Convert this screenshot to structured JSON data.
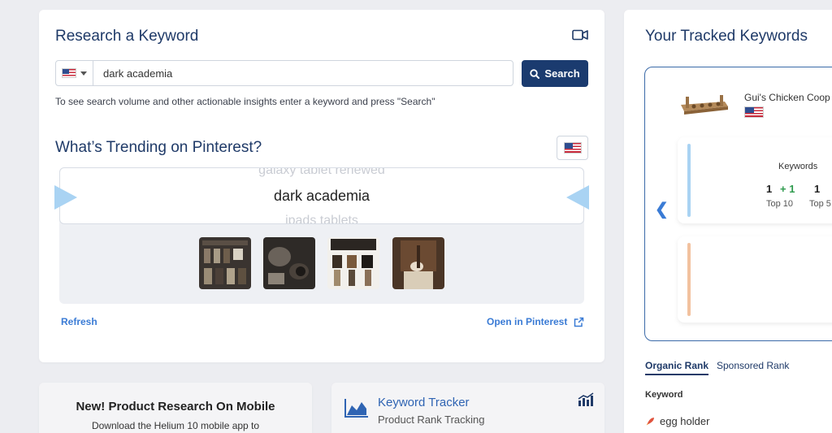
{
  "research": {
    "title": "Research a Keyword",
    "country": "US",
    "keyword_value": "dark academia",
    "search_label": "Search",
    "helper_text": "To see search volume and other actionable insights enter a keyword and press \"Search\""
  },
  "trending": {
    "title": "What’s Trending on Pinterest?",
    "prev_item": "galaxy tablet renewed",
    "current_item": "dark academia",
    "next_item": "ipads tablets",
    "refresh_label": "Refresh",
    "open_label": "Open in Pinterest"
  },
  "tracked": {
    "title": "Your Tracked Keywords",
    "product_name": "Gui's Chicken Coop",
    "keywords_label": "Keywords",
    "top10_value": "1",
    "top10_delta": "+ 1",
    "top10_label": "Top 10",
    "top5_value": "1",
    "top5_label": "Top 5",
    "organic_tab": "Organic Rank",
    "sponsored_tab": "Sponsored Rank",
    "keyword_column": "Keyword",
    "keyword_row": "egg holder"
  },
  "mobile_promo": {
    "title": "New! Product Research On Mobile",
    "subtitle": "Download the Helium 10 mobile app to"
  },
  "keyword_tracker": {
    "title": "Keyword Tracker",
    "subtitle": "Product Rank Tracking"
  },
  "colors": {
    "brand_navy": "#1b3b6f",
    "link_blue": "#3a7bd5",
    "positive_green": "#2e9a4d",
    "rank_bar_blue": "#a9d3f3",
    "rank_bar_orange": "#f2c29f"
  }
}
